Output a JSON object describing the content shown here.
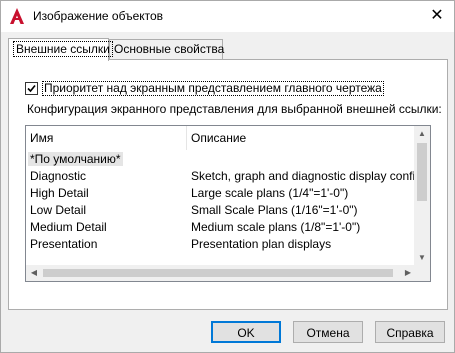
{
  "window": {
    "title": "Изображение объектов",
    "close_glyph": "✕"
  },
  "tabs": [
    {
      "label": "Внешние ссылки",
      "active": true
    },
    {
      "label": "Основные свойства",
      "active": false
    }
  ],
  "options": {
    "priority_checkbox": {
      "label": "Приоритет над экранным представлением главного чертежа",
      "checked": true
    },
    "config_label": "Конфигурация экранного представления для выбранной внешней ссылки:"
  },
  "list": {
    "columns": [
      "Имя",
      "Описание"
    ],
    "rows": [
      {
        "name": "*По умолчанию*",
        "description": "",
        "selected": true
      },
      {
        "name": "Diagnostic",
        "description": "Sketch, graph and diagnostic display configur."
      },
      {
        "name": "High Detail",
        "description": "Large scale plans (1/4\"=1'-0\")"
      },
      {
        "name": "Low Detail",
        "description": "Small Scale Plans (1/16\"=1'-0\")"
      },
      {
        "name": "Medium Detail",
        "description": "Medium scale plans (1/8\"=1'-0\")"
      },
      {
        "name": "Presentation",
        "description": "Presentation plan displays"
      }
    ]
  },
  "buttons": {
    "ok": "OK",
    "cancel": "Отмена",
    "help": "Справка"
  },
  "colors": {
    "accent": "#0078d7",
    "app_icon": "#c8102e"
  }
}
